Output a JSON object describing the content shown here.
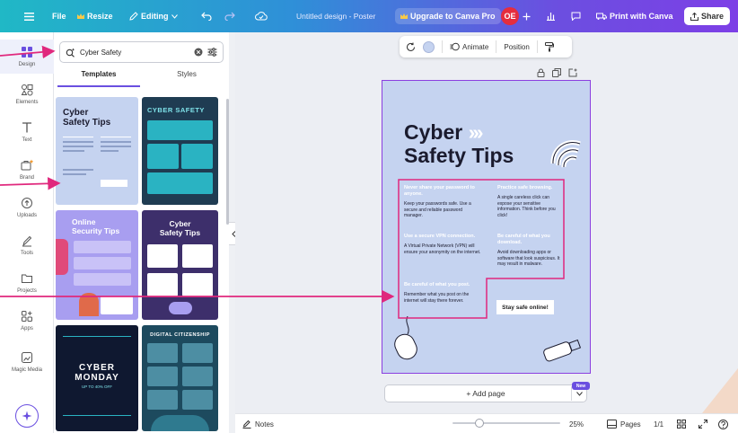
{
  "topbar": {
    "file": "File",
    "resize": "Resize",
    "editing": "Editing",
    "doc_title": "Untitled design - Poster",
    "upgrade": "Upgrade to Canva Pro",
    "avatar_initials": "OE",
    "print": "Print with Canva",
    "share": "Share"
  },
  "rail": {
    "design": "Design",
    "elements": "Elements",
    "text": "Text",
    "brand": "Brand",
    "uploads": "Uploads",
    "tools": "Tools",
    "projects": "Projects",
    "apps": "Apps",
    "magic_media": "Magic Media"
  },
  "panel": {
    "search_value": "Cyber Safety",
    "tab_templates": "Templates",
    "tab_styles": "Styles",
    "templates": [
      {
        "line1": "Cyber",
        "line2": "Safety Tips"
      },
      {
        "line1": "CYBER SAFETY",
        "line2": ""
      },
      {
        "line1": "Online",
        "line2": "Security Tips"
      },
      {
        "line1": "Cyber",
        "line2": "Safety Tips"
      },
      {
        "line1": "CYBER",
        "line2": "MONDAY",
        "line3": "UP TO 40% OFF"
      },
      {
        "line1": "DIGITAL CITIZENSHIP",
        "line2": ""
      }
    ]
  },
  "toolbar": {
    "animate": "Animate",
    "position": "Position"
  },
  "poster": {
    "title_line1": "Cyber",
    "title_chevrons": "›››",
    "title_line2": "Safety Tips",
    "tips": [
      {
        "heading": "Never share your password to anyone.",
        "body": "Keep your passwords safe. Use a secure and reliable password manager."
      },
      {
        "heading": "Practice safe browsing.",
        "body": "A single careless click can expose your sensitive information. Think before you click!"
      },
      {
        "heading": "Use a secure VPN connection.",
        "body": "A Virtual Private Network (VPN) will ensure your anonymity on the internet."
      },
      {
        "heading": "Be careful of what you download.",
        "body": "Avoid downloading apps or software that look suspicious. It may result in malware."
      },
      {
        "heading": "Be careful of what you post.",
        "body": "Remember what you post on the internet will stay there forever."
      }
    ],
    "cta": "Stay safe online!"
  },
  "add_page": "+ Add page",
  "new_badge": "New",
  "bottombar": {
    "notes": "Notes",
    "zoom": "25%",
    "zoom_fraction": 0.25,
    "pages": "Pages",
    "page_count": "1/1"
  },
  "colors": {
    "accent": "#6a4fe0",
    "poster_bg": "#c5d3f0",
    "annotation": "#e0287d",
    "avatar": "#e52d3e"
  }
}
